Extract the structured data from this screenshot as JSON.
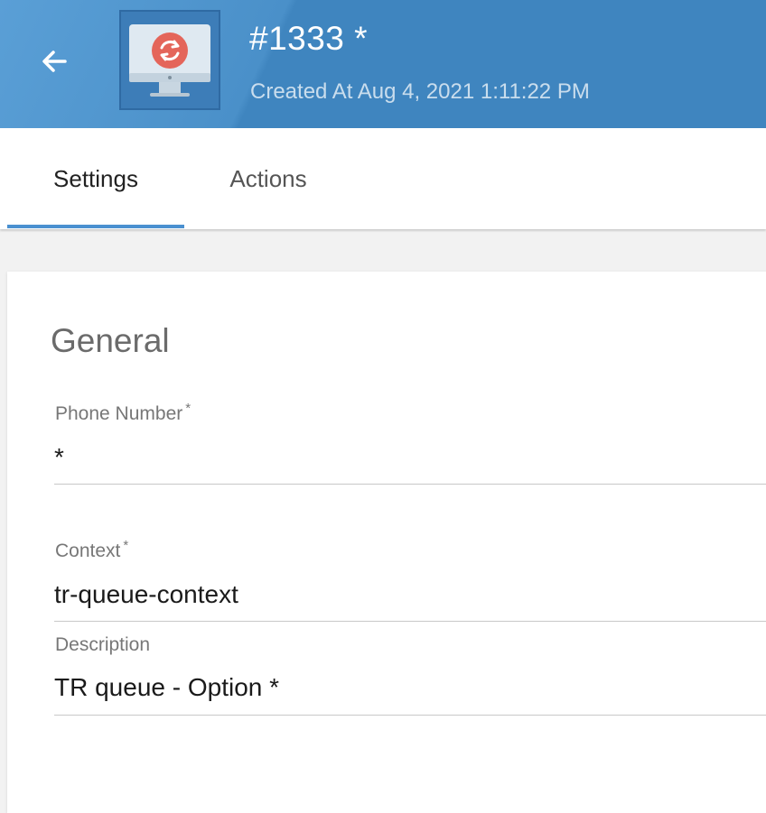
{
  "header": {
    "title": "#1333 *",
    "subtitle": "Created At Aug 4, 2021 1:11:22 PM",
    "back_icon": "arrow-left-icon",
    "avatar_icon": "monitor-sync-icon",
    "background_color": "#4a90c9"
  },
  "tabs": [
    {
      "label": "Settings",
      "active": true
    },
    {
      "label": "Actions",
      "active": false
    }
  ],
  "accent_color": "#4a90d0",
  "form": {
    "section_title": "General",
    "required_mark": "*",
    "phone_number": {
      "label": "Phone Number",
      "value": "*",
      "required": true
    },
    "context": {
      "label": "Context",
      "value": "tr-queue-context",
      "required": true
    },
    "description": {
      "label": "Description",
      "value": "TR queue - Option *",
      "required": false
    }
  }
}
